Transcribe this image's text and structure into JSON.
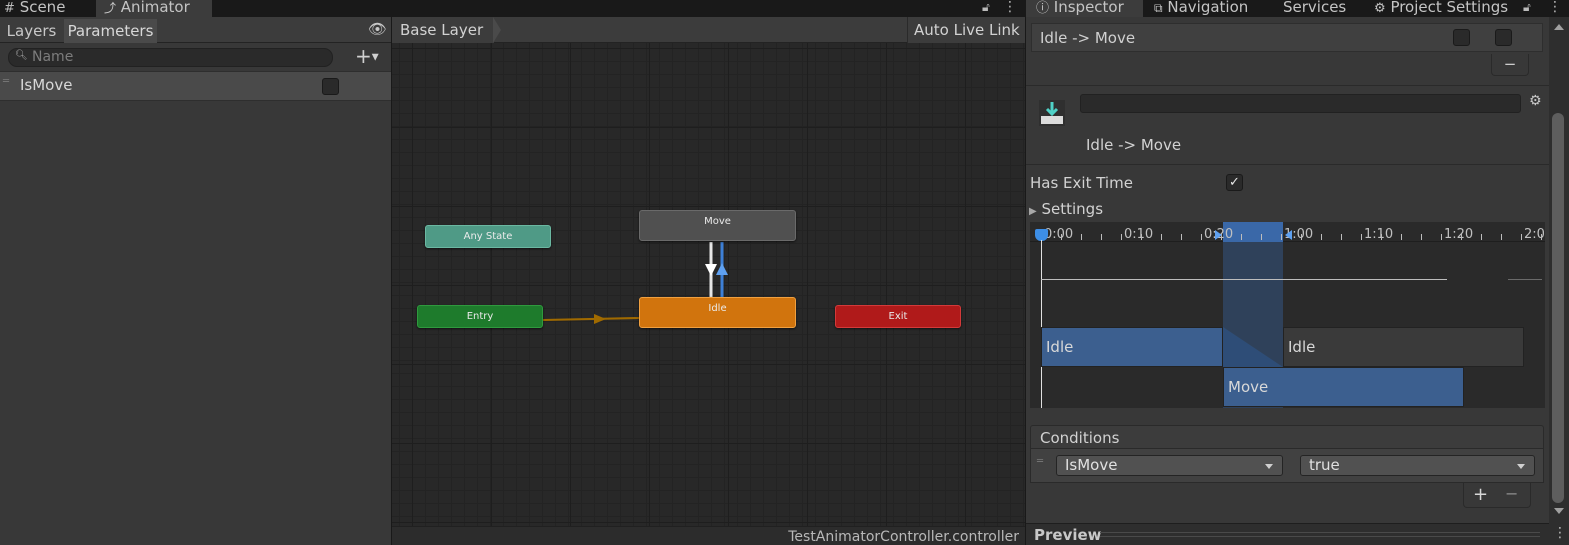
{
  "tabs_left": [
    {
      "label": "Scene",
      "icon": "grid-icon"
    },
    {
      "label": "Animator",
      "icon": "animator-icon"
    }
  ],
  "tabs_right": [
    {
      "label": "Inspector",
      "icon": "info-icon"
    },
    {
      "label": "Navigation",
      "icon": "navigation-icon"
    },
    {
      "label": "Services",
      "icon": ""
    },
    {
      "label": "Project Settings",
      "icon": "gear-icon"
    }
  ],
  "animator": {
    "subtabs": [
      "Layers",
      "Parameters"
    ],
    "search_placeholder": "Name",
    "parameters": [
      {
        "name": "IsMove",
        "value": false
      }
    ],
    "breadcrumb": "Base Layer",
    "auto_live_link": "Auto Live Link",
    "footer": "TestAnimatorController.controller",
    "nodes": {
      "any_state": "Any State",
      "entry": "Entry",
      "idle": "Idle",
      "move": "Move",
      "exit": "Exit"
    }
  },
  "inspector": {
    "transition_list_item": "Idle -> Move",
    "name_field_value": "",
    "transition_title": "Idle -> Move",
    "has_exit_time_label": "Has Exit Time",
    "has_exit_time": true,
    "settings_label": "Settings",
    "timeline": {
      "ticks": [
        "0:00",
        "0:10",
        "0:20",
        "1:00",
        "1:10",
        "1:20",
        "2:0"
      ],
      "clip_top_left": "Idle",
      "clip_top_right": "Idle",
      "clip_bottom": "Move"
    },
    "conditions_label": "Conditions",
    "condition": {
      "parameter": "IsMove",
      "value": "true"
    },
    "plus": "+",
    "minus": "−",
    "preview_label": "Preview"
  },
  "colors": {
    "any_state": "#4f9a86",
    "entry": "#1e7b2c",
    "idle": "#d1740d",
    "move": "#505050",
    "exit": "#b01a1a",
    "transition_highlight": "#3d7fd6",
    "entry_arrow": "#a06a00"
  }
}
